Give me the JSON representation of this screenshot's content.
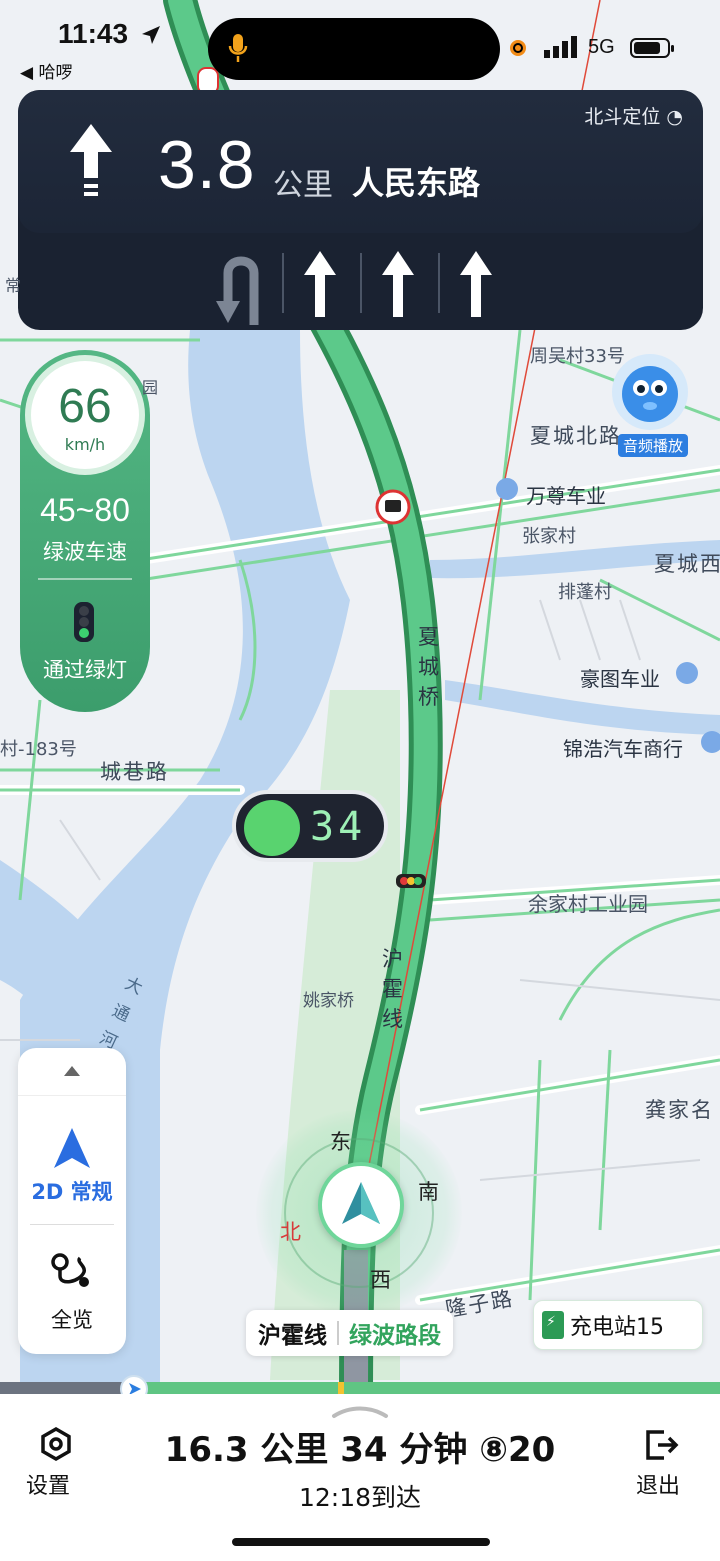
{
  "status_bar": {
    "time": "11:43",
    "back_app": "◀ 哈啰",
    "network": "5G"
  },
  "guidance": {
    "positioning": "北斗定位",
    "distance_value": "3.8",
    "distance_unit": "公里",
    "next_road": "人民东路"
  },
  "green_wave": {
    "current_speed": "66",
    "speed_unit": "km/h",
    "speed_range": "45~80",
    "range_label": "绿波车速",
    "pass_label": "通过绿灯"
  },
  "signal_countdown": "34",
  "map": {
    "labels": {
      "zhouwu_village": "周吴村33号",
      "xiacheng_north_road": "夏城北路",
      "wanzun_auto": "万尊车业",
      "zhangjia_village": "张家村",
      "xiacheng_west": "夏城西",
      "paipeng_village": "排蓬村",
      "haotu_auto": "豪图车业",
      "jinhao_auto": "锦浩汽车商行",
      "cun_183": "村-183号",
      "chengxiang_road": "城巷路",
      "yujiacun_industrial": "余家村工业园",
      "yaojia_bridge": "姚家桥",
      "gongjia": "龚家名",
      "longzi_road": "隆子路",
      "xiacheng_bridge": "夏城桥",
      "huhuo_line": "沪霍线",
      "datong_river": "大通河",
      "yuan": "园",
      "chang": "常"
    },
    "audio_poi_label": "音频播放"
  },
  "view_mode": {
    "mode_label": "2D 常规",
    "overview_label": "全览"
  },
  "compass": {
    "east": "东",
    "south": "南",
    "west": "西",
    "north": "北"
  },
  "road_tag": {
    "road": "沪霍线",
    "section": "绿波路段"
  },
  "charging": "充电站15",
  "route_progress_fraction": 0.18,
  "bottom_bar": {
    "settings_label": "设置",
    "trip_summary": "16.3 公里 34 分钟 ⑧20",
    "arrival": "12:18到达",
    "exit_label": "退出"
  },
  "colors": {
    "route_green": "#4cb87a",
    "guide_bg": "#1a2231",
    "accent_blue": "#2a6de0"
  }
}
